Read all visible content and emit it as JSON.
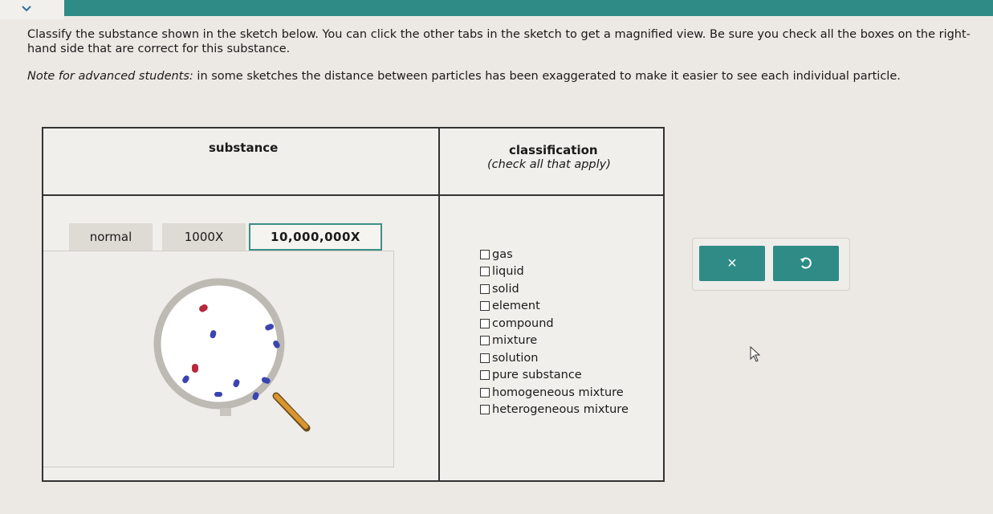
{
  "header": {
    "chevron_icon": "chevron-down-icon"
  },
  "instructions": {
    "text": "Classify the substance shown in the sketch below. You can click the other tabs in the sketch to get a magnified view. Be sure you check all the boxes on the right-hand side that are correct for this substance.",
    "note_label": "Note for advanced students:",
    "note_text": " in some sketches the distance between particles has been exaggerated to make it easier to see each individual particle."
  },
  "table": {
    "substance_header": "substance",
    "classification_header": "classification",
    "classification_subheader": "(check all that apply)",
    "tabs": [
      "normal",
      "1000X",
      "10,000,000X"
    ],
    "active_tab": "10,000,000X",
    "options": [
      "gas",
      "liquid",
      "solid",
      "element",
      "compound",
      "mixture",
      "solution",
      "pure substance",
      "homogeneous mixture",
      "heterogeneous mixture"
    ]
  },
  "actions": {
    "clear_label": "×",
    "undo_icon": "undo-icon"
  },
  "colors": {
    "teal": "#2e8b86",
    "blue_particle": "#3a44b0",
    "red_particle": "#b8283c"
  }
}
